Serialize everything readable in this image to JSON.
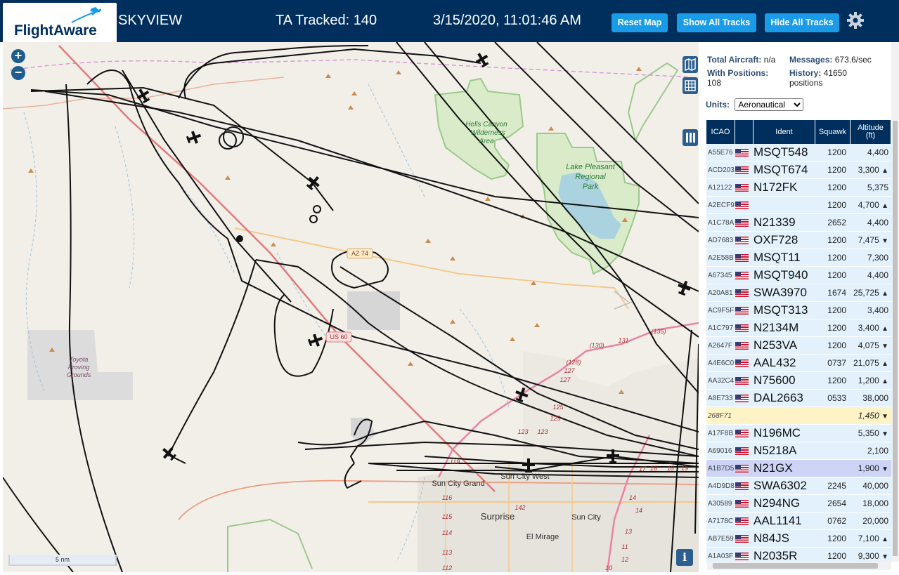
{
  "header": {
    "logo_text": "FlightAware",
    "app_name": "SKYVIEW",
    "tracked_text": "TA Tracked: 140",
    "datetime": "3/15/2020, 11:01:46 AM",
    "buttons": {
      "reset": "Reset Map",
      "show_all": "Show All Tracks",
      "hide_all": "Hide All Tracks"
    },
    "settings_icon": "gear-icon"
  },
  "map": {
    "zoom_in": "+",
    "zoom_out": "−",
    "scale_label": "5 nm",
    "info_label": "i",
    "labels": {
      "hells_canyon": "Hells Canyon",
      "wilderness": "Wilderness",
      "area": "Area",
      "lake_pleasant": "Lake Pleasant",
      "regional": "Regional",
      "park": "Park",
      "toyota": "Toyota",
      "proving": "Proving",
      "grounds": "Grounds",
      "az74": "AZ 74",
      "us60": "US 60",
      "sun_city_grand": "Sun City Grand",
      "sun_city_west": "Sun City West",
      "surprise": "Surprise",
      "sun_city": "Sun City",
      "el_mirage": "El Mirage"
    },
    "road_numbers": [
      "(135)",
      "131",
      "(130)",
      "(128)",
      "127",
      "127",
      "125",
      "125",
      "123",
      "123",
      "119",
      "116",
      "115",
      "114",
      "113",
      "112",
      "142",
      "14",
      "10",
      "17",
      "16",
      "18",
      "19",
      "13",
      "11",
      "12",
      "14"
    ]
  },
  "stats": {
    "total_aircraft_label": "Total Aircraft:",
    "total_aircraft_value": "n/a",
    "messages_label": "Messages:",
    "messages_value": "673.6/sec",
    "with_positions_label": "With Positions:",
    "with_positions_value": "108",
    "history_label": "History:",
    "history_value": "41650",
    "history_unit": "positions"
  },
  "units": {
    "label": "Units:",
    "selected": "Aeronautical"
  },
  "table": {
    "headers": {
      "icao": "ICAO",
      "ident": "Ident",
      "squawk": "Squawk",
      "altitude": "Altitude",
      "altitude_unit": "(ft)"
    },
    "rows": [
      {
        "icao": "A55E76",
        "flag": true,
        "ident": "MSQT548",
        "squawk": "1200",
        "alt": "4,400",
        "trend": "",
        "style": ""
      },
      {
        "icao": "ACD203",
        "flag": true,
        "ident": "MSQT674",
        "squawk": "1200",
        "alt": "3,300",
        "trend": "▲",
        "style": ""
      },
      {
        "icao": "A12122",
        "flag": true,
        "ident": "N172FK",
        "squawk": "1200",
        "alt": "5,375",
        "trend": "",
        "style": ""
      },
      {
        "icao": "A2ECF9",
        "flag": true,
        "ident": "",
        "squawk": "1200",
        "alt": "4,700",
        "trend": "▲",
        "style": ""
      },
      {
        "icao": "A1C78A",
        "flag": true,
        "ident": "N21339",
        "squawk": "2652",
        "alt": "4,400",
        "trend": "",
        "style": ""
      },
      {
        "icao": "AD7683",
        "flag": true,
        "ident": "OXF728",
        "squawk": "1200",
        "alt": "7,475",
        "trend": "▼",
        "style": ""
      },
      {
        "icao": "A2E58B",
        "flag": true,
        "ident": "MSQT11",
        "squawk": "1200",
        "alt": "7,300",
        "trend": "",
        "style": ""
      },
      {
        "icao": "A67345",
        "flag": true,
        "ident": "MSQT940",
        "squawk": "1200",
        "alt": "4,400",
        "trend": "",
        "style": ""
      },
      {
        "icao": "A20A81",
        "flag": true,
        "ident": "SWA3970",
        "squawk": "1674",
        "alt": "25,725",
        "trend": "▲",
        "style": ""
      },
      {
        "icao": "AC9F5F",
        "flag": true,
        "ident": "MSQT313",
        "squawk": "1200",
        "alt": "3,400",
        "trend": "",
        "style": ""
      },
      {
        "icao": "A1C797",
        "flag": true,
        "ident": "N2134M",
        "squawk": "1200",
        "alt": "3,400",
        "trend": "▲",
        "style": ""
      },
      {
        "icao": "A2647F",
        "flag": true,
        "ident": "N253VA",
        "squawk": "1200",
        "alt": "4,075",
        "trend": "▼",
        "style": ""
      },
      {
        "icao": "A4E6C0",
        "flag": true,
        "ident": "AAL432",
        "squawk": "0737",
        "alt": "21,075",
        "trend": "▲",
        "style": ""
      },
      {
        "icao": "AA32C4",
        "flag": true,
        "ident": "N75600",
        "squawk": "1200",
        "alt": "1,200",
        "trend": "▲",
        "style": ""
      },
      {
        "icao": "A8E733",
        "flag": true,
        "ident": "DAL2663",
        "squawk": "0533",
        "alt": "38,000",
        "trend": "",
        "style": ""
      },
      {
        "icao": "268F71",
        "flag": false,
        "ident": "",
        "squawk": "",
        "alt": "1,450",
        "trend": "▼",
        "style": "yellow"
      },
      {
        "icao": "A17F8B",
        "flag": true,
        "ident": "N196MC",
        "squawk": "",
        "alt": "5,350",
        "trend": "▼",
        "style": ""
      },
      {
        "icao": "A69016",
        "flag": true,
        "ident": "N5218A",
        "squawk": "",
        "alt": "2,100",
        "trend": "",
        "style": ""
      },
      {
        "icao": "A1B7D5",
        "flag": true,
        "ident": "N21GX",
        "squawk": "",
        "alt": "1,900",
        "trend": "▼",
        "style": "sel"
      },
      {
        "icao": "A4D9D8",
        "flag": true,
        "ident": "SWA6302",
        "squawk": "2245",
        "alt": "40,000",
        "trend": "",
        "style": ""
      },
      {
        "icao": "A30589",
        "flag": true,
        "ident": "N294NG",
        "squawk": "2654",
        "alt": "18,000",
        "trend": "",
        "style": ""
      },
      {
        "icao": "A7178C",
        "flag": true,
        "ident": "AAL1141",
        "squawk": "0762",
        "alt": "20,000",
        "trend": "",
        "style": ""
      },
      {
        "icao": "AB7E59",
        "flag": true,
        "ident": "N84JS",
        "squawk": "1200",
        "alt": "7,100",
        "trend": "▲",
        "style": ""
      },
      {
        "icao": "A1A03F",
        "flag": true,
        "ident": "N2035R",
        "squawk": "1200",
        "alt": "9,300",
        "trend": "▼",
        "style": ""
      }
    ]
  }
}
